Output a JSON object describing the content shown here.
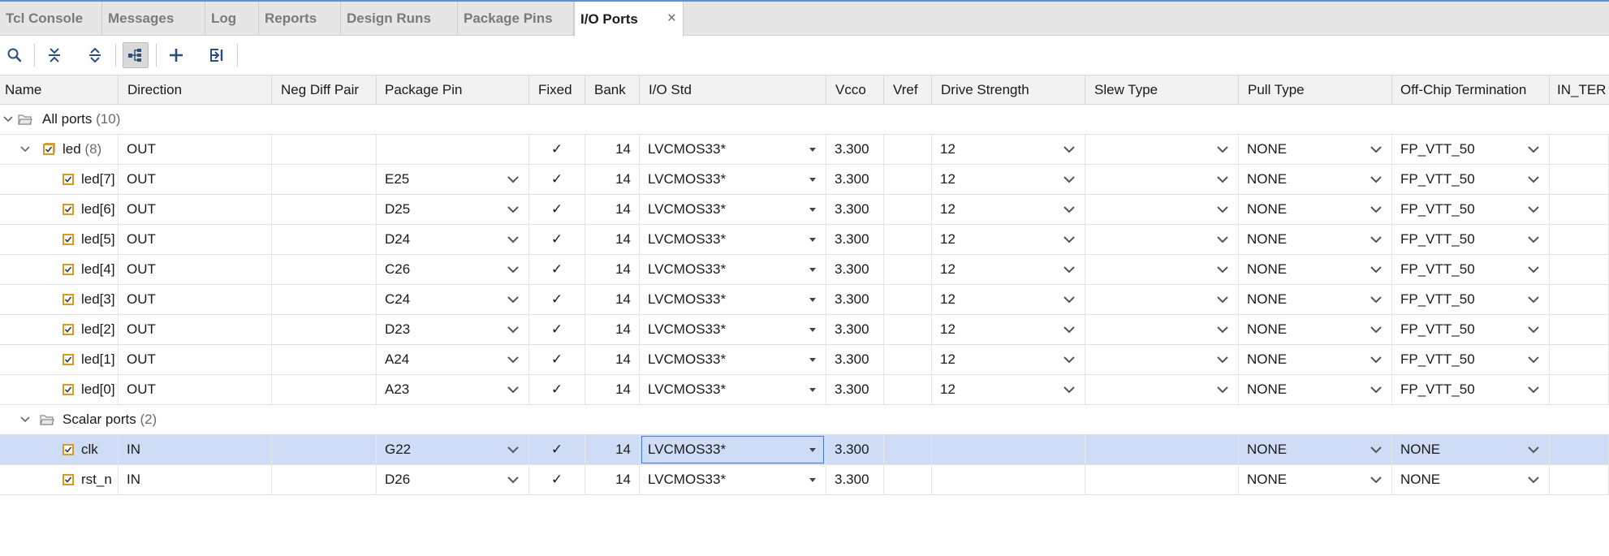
{
  "tabs": [
    {
      "label": "Tcl Console",
      "active": false
    },
    {
      "label": "Messages",
      "active": false
    },
    {
      "label": "Log",
      "active": false
    },
    {
      "label": "Reports",
      "active": false
    },
    {
      "label": "Design Runs",
      "active": false
    },
    {
      "label": "Package Pins",
      "active": false
    },
    {
      "label": "I/O Ports",
      "active": true
    }
  ],
  "close_glyph": "×",
  "toolbar": {
    "buttons": [
      "search-icon",
      "collapse-all-icon",
      "expand-all-icon",
      "group-by-interface-icon",
      "add-icon",
      "export-icon"
    ],
    "pressed": "group-by-interface-icon"
  },
  "columns": [
    "Name",
    "Direction",
    "Neg Diff Pair",
    "Package Pin",
    "Fixed",
    "Bank",
    "I/O Std",
    "Vcco",
    "Vref",
    "Drive Strength",
    "Slew Type",
    "Pull Type",
    "Off-Chip Termination",
    "IN_TER"
  ],
  "groups": {
    "all_ports": {
      "label": "All ports",
      "count": "(10)"
    },
    "led_bus": {
      "name": "led",
      "count": "(8)",
      "direction": "OUT",
      "fixed": "✓",
      "bank": "14",
      "io_std": "LVCMOS33*",
      "vcco": "3.300",
      "drive": "12",
      "pull": "NONE",
      "term": "FP_VTT_50"
    },
    "scalar_ports": {
      "label": "Scalar ports",
      "count": "(2)"
    }
  },
  "led_rows": [
    {
      "name": "led[7]",
      "direction": "OUT",
      "pin": "E25",
      "fixed": "✓",
      "bank": "14",
      "io_std": "LVCMOS33*",
      "vcco": "3.300",
      "drive": "12",
      "pull": "NONE",
      "term": "FP_VTT_50"
    },
    {
      "name": "led[6]",
      "direction": "OUT",
      "pin": "D25",
      "fixed": "✓",
      "bank": "14",
      "io_std": "LVCMOS33*",
      "vcco": "3.300",
      "drive": "12",
      "pull": "NONE",
      "term": "FP_VTT_50"
    },
    {
      "name": "led[5]",
      "direction": "OUT",
      "pin": "D24",
      "fixed": "✓",
      "bank": "14",
      "io_std": "LVCMOS33*",
      "vcco": "3.300",
      "drive": "12",
      "pull": "NONE",
      "term": "FP_VTT_50"
    },
    {
      "name": "led[4]",
      "direction": "OUT",
      "pin": "C26",
      "fixed": "✓",
      "bank": "14",
      "io_std": "LVCMOS33*",
      "vcco": "3.300",
      "drive": "12",
      "pull": "NONE",
      "term": "FP_VTT_50"
    },
    {
      "name": "led[3]",
      "direction": "OUT",
      "pin": "C24",
      "fixed": "✓",
      "bank": "14",
      "io_std": "LVCMOS33*",
      "vcco": "3.300",
      "drive": "12",
      "pull": "NONE",
      "term": "FP_VTT_50"
    },
    {
      "name": "led[2]",
      "direction": "OUT",
      "pin": "D23",
      "fixed": "✓",
      "bank": "14",
      "io_std": "LVCMOS33*",
      "vcco": "3.300",
      "drive": "12",
      "pull": "NONE",
      "term": "FP_VTT_50"
    },
    {
      "name": "led[1]",
      "direction": "OUT",
      "pin": "A24",
      "fixed": "✓",
      "bank": "14",
      "io_std": "LVCMOS33*",
      "vcco": "3.300",
      "drive": "12",
      "pull": "NONE",
      "term": "FP_VTT_50"
    },
    {
      "name": "led[0]",
      "direction": "OUT",
      "pin": "A23",
      "fixed": "✓",
      "bank": "14",
      "io_std": "LVCMOS33*",
      "vcco": "3.300",
      "drive": "12",
      "pull": "NONE",
      "term": "FP_VTT_50"
    }
  ],
  "scalar_rows": [
    {
      "name": "clk",
      "direction": "IN",
      "pin": "G22",
      "fixed": "✓",
      "bank": "14",
      "io_std": "LVCMOS33*",
      "vcco": "3.300",
      "pull": "NONE",
      "term": "NONE",
      "selected": true
    },
    {
      "name": "rst_n",
      "direction": "IN",
      "pin": "D26",
      "fixed": "✓",
      "bank": "14",
      "io_std": "LVCMOS33*",
      "vcco": "3.300",
      "pull": "NONE",
      "term": "NONE",
      "selected": false
    }
  ],
  "colors": {
    "accent": "#5b8fd6",
    "selection": "#cfdcf5",
    "port_icon": "#d99a1e"
  }
}
